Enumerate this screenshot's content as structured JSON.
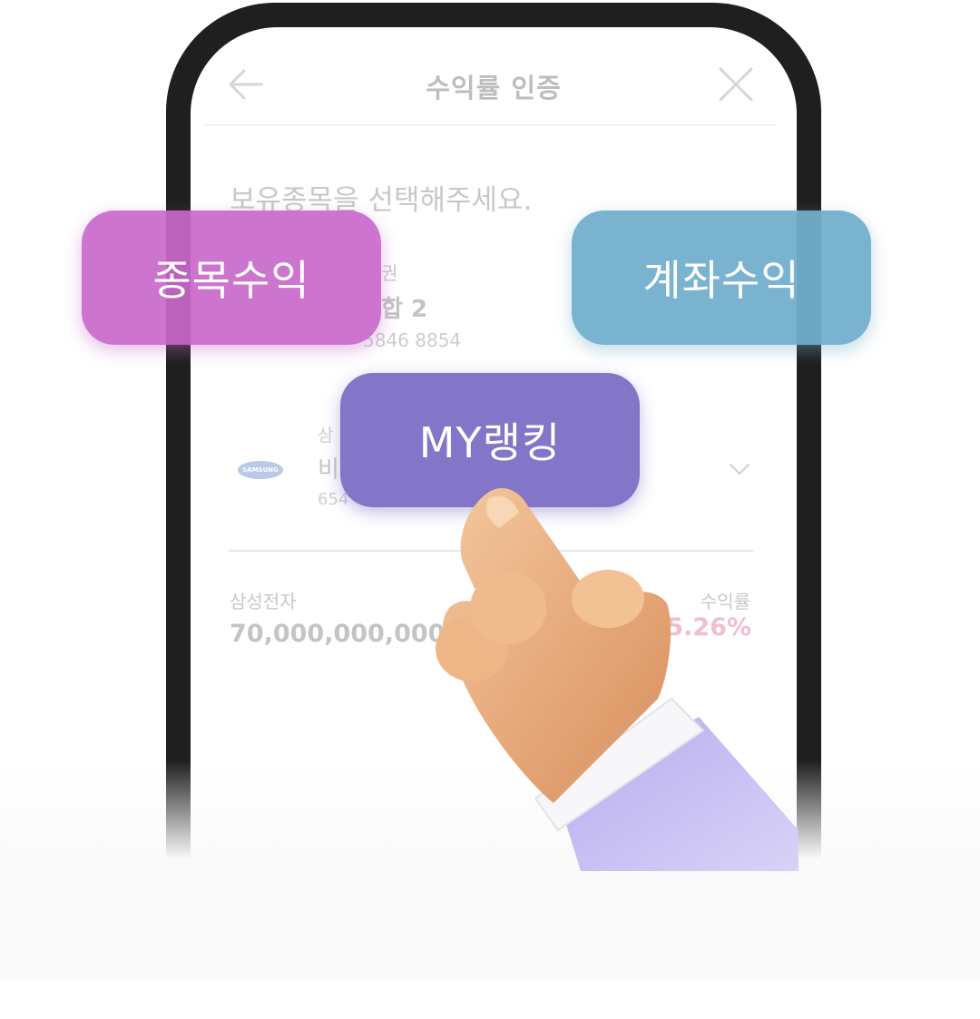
{
  "screen": {
    "title": "수익률 인증",
    "prompt": "보유종목을 선택해주세요.",
    "account": {
      "label": "권",
      "name": "합 2",
      "number": "5846 8854"
    },
    "stock": {
      "logo_text": "SAMSUNG",
      "group": "삼",
      "name": "비",
      "code": "654"
    },
    "summary": {
      "stock_label": "삼성전자",
      "amount": "70,000,000,000원 (",
      "return_label": "수익률",
      "return_value": "5.26%"
    }
  },
  "buttons": {
    "stock_return": "종목수익",
    "account_return": "계좌수익",
    "my_ranking": "MY랭킹"
  },
  "colors": {
    "stock_pill": "#c868ca",
    "account_pill": "#73afcc",
    "ranking_pill": "#7c6ec4",
    "return_positive": "#f1bfd0",
    "phone_frame": "#1f1f1f"
  },
  "icons": [
    "back-arrow-icon",
    "close-icon",
    "chevron-down-icon",
    "samsung-logo",
    "pointing-hand-illustration"
  ]
}
